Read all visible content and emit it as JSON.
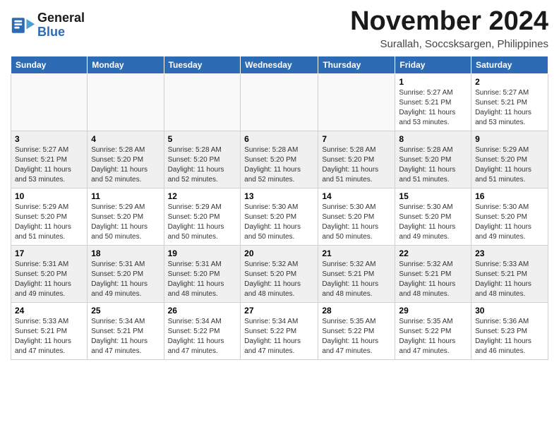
{
  "logo": {
    "line1": "General",
    "line2": "Blue"
  },
  "title": "November 2024",
  "subtitle": "Surallah, Soccsksargen, Philippines",
  "headers": [
    "Sunday",
    "Monday",
    "Tuesday",
    "Wednesday",
    "Thursday",
    "Friday",
    "Saturday"
  ],
  "weeks": [
    [
      {
        "day": "",
        "info": ""
      },
      {
        "day": "",
        "info": ""
      },
      {
        "day": "",
        "info": ""
      },
      {
        "day": "",
        "info": ""
      },
      {
        "day": "",
        "info": ""
      },
      {
        "day": "1",
        "info": "Sunrise: 5:27 AM\nSunset: 5:21 PM\nDaylight: 11 hours\nand 53 minutes."
      },
      {
        "day": "2",
        "info": "Sunrise: 5:27 AM\nSunset: 5:21 PM\nDaylight: 11 hours\nand 53 minutes."
      }
    ],
    [
      {
        "day": "3",
        "info": "Sunrise: 5:27 AM\nSunset: 5:21 PM\nDaylight: 11 hours\nand 53 minutes."
      },
      {
        "day": "4",
        "info": "Sunrise: 5:28 AM\nSunset: 5:20 PM\nDaylight: 11 hours\nand 52 minutes."
      },
      {
        "day": "5",
        "info": "Sunrise: 5:28 AM\nSunset: 5:20 PM\nDaylight: 11 hours\nand 52 minutes."
      },
      {
        "day": "6",
        "info": "Sunrise: 5:28 AM\nSunset: 5:20 PM\nDaylight: 11 hours\nand 52 minutes."
      },
      {
        "day": "7",
        "info": "Sunrise: 5:28 AM\nSunset: 5:20 PM\nDaylight: 11 hours\nand 51 minutes."
      },
      {
        "day": "8",
        "info": "Sunrise: 5:28 AM\nSunset: 5:20 PM\nDaylight: 11 hours\nand 51 minutes."
      },
      {
        "day": "9",
        "info": "Sunrise: 5:29 AM\nSunset: 5:20 PM\nDaylight: 11 hours\nand 51 minutes."
      }
    ],
    [
      {
        "day": "10",
        "info": "Sunrise: 5:29 AM\nSunset: 5:20 PM\nDaylight: 11 hours\nand 51 minutes."
      },
      {
        "day": "11",
        "info": "Sunrise: 5:29 AM\nSunset: 5:20 PM\nDaylight: 11 hours\nand 50 minutes."
      },
      {
        "day": "12",
        "info": "Sunrise: 5:29 AM\nSunset: 5:20 PM\nDaylight: 11 hours\nand 50 minutes."
      },
      {
        "day": "13",
        "info": "Sunrise: 5:30 AM\nSunset: 5:20 PM\nDaylight: 11 hours\nand 50 minutes."
      },
      {
        "day": "14",
        "info": "Sunrise: 5:30 AM\nSunset: 5:20 PM\nDaylight: 11 hours\nand 50 minutes."
      },
      {
        "day": "15",
        "info": "Sunrise: 5:30 AM\nSunset: 5:20 PM\nDaylight: 11 hours\nand 49 minutes."
      },
      {
        "day": "16",
        "info": "Sunrise: 5:30 AM\nSunset: 5:20 PM\nDaylight: 11 hours\nand 49 minutes."
      }
    ],
    [
      {
        "day": "17",
        "info": "Sunrise: 5:31 AM\nSunset: 5:20 PM\nDaylight: 11 hours\nand 49 minutes."
      },
      {
        "day": "18",
        "info": "Sunrise: 5:31 AM\nSunset: 5:20 PM\nDaylight: 11 hours\nand 49 minutes."
      },
      {
        "day": "19",
        "info": "Sunrise: 5:31 AM\nSunset: 5:20 PM\nDaylight: 11 hours\nand 48 minutes."
      },
      {
        "day": "20",
        "info": "Sunrise: 5:32 AM\nSunset: 5:20 PM\nDaylight: 11 hours\nand 48 minutes."
      },
      {
        "day": "21",
        "info": "Sunrise: 5:32 AM\nSunset: 5:21 PM\nDaylight: 11 hours\nand 48 minutes."
      },
      {
        "day": "22",
        "info": "Sunrise: 5:32 AM\nSunset: 5:21 PM\nDaylight: 11 hours\nand 48 minutes."
      },
      {
        "day": "23",
        "info": "Sunrise: 5:33 AM\nSunset: 5:21 PM\nDaylight: 11 hours\nand 48 minutes."
      }
    ],
    [
      {
        "day": "24",
        "info": "Sunrise: 5:33 AM\nSunset: 5:21 PM\nDaylight: 11 hours\nand 47 minutes."
      },
      {
        "day": "25",
        "info": "Sunrise: 5:34 AM\nSunset: 5:21 PM\nDaylight: 11 hours\nand 47 minutes."
      },
      {
        "day": "26",
        "info": "Sunrise: 5:34 AM\nSunset: 5:22 PM\nDaylight: 11 hours\nand 47 minutes."
      },
      {
        "day": "27",
        "info": "Sunrise: 5:34 AM\nSunset: 5:22 PM\nDaylight: 11 hours\nand 47 minutes."
      },
      {
        "day": "28",
        "info": "Sunrise: 5:35 AM\nSunset: 5:22 PM\nDaylight: 11 hours\nand 47 minutes."
      },
      {
        "day": "29",
        "info": "Sunrise: 5:35 AM\nSunset: 5:22 PM\nDaylight: 11 hours\nand 47 minutes."
      },
      {
        "day": "30",
        "info": "Sunrise: 5:36 AM\nSunset: 5:23 PM\nDaylight: 11 hours\nand 46 minutes."
      }
    ]
  ]
}
